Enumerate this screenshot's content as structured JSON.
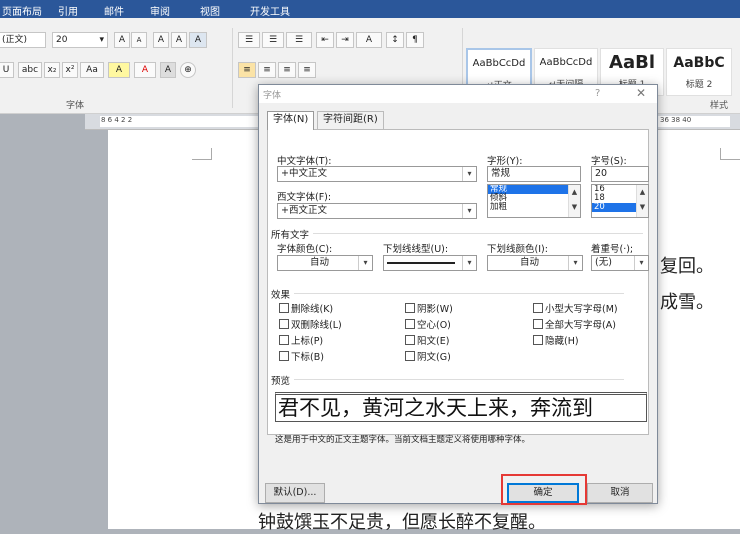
{
  "ribbon_tabs": [
    "页面布局",
    "引用",
    "邮件",
    "审阅",
    "视图",
    "开发工具"
  ],
  "ribbon": {
    "font_name": "(正文)",
    "font_size": "20",
    "grow_font": "A",
    "shrink_font": "A",
    "clear_format": "A",
    "phonetic_guide": "A",
    "group_font": "字体",
    "group_styles": "样式",
    "font_row2": [
      "abc",
      "x₂",
      "x²",
      "Aa",
      "A",
      "A",
      "A"
    ],
    "para_row1": [
      "☰",
      "☰",
      "☰",
      "⇤",
      "⇥",
      "A",
      "↕",
      "¶"
    ],
    "styles": [
      {
        "sample": "AaBbCcDd",
        "name": "↵正文"
      },
      {
        "sample": "AaBbCcDd",
        "name": "↵无间隔"
      },
      {
        "sample": "AaBl",
        "name": "标题 1"
      },
      {
        "sample": "AaBbC",
        "name": "标题 2"
      }
    ],
    "ruler_marks": "8   6   4   2       2",
    "ruler_marks_right": "36   38   40"
  },
  "document": {
    "line_partial_1": "复回。",
    "line_partial_2": "成雪。",
    "line_bottom": "钟鼓馔玉不足贵，但愿长醉不复醒。"
  },
  "dialog": {
    "title": "字体",
    "help": "?",
    "close": "✕",
    "tabs": [
      "字体(N)",
      "字符间距(R)"
    ],
    "cn_font_label": "中文字体(T):",
    "cn_font_value": "+中文正文",
    "west_font_label": "西文字体(F):",
    "west_font_value": "+西文正文",
    "style_label": "字形(Y):",
    "style_value": "常规",
    "style_list": [
      "常规",
      "倾斜",
      "加粗"
    ],
    "size_label": "字号(S):",
    "size_value": "20",
    "size_list": [
      "16",
      "18",
      "20"
    ],
    "all_text_label": "所有文字",
    "font_color_label": "字体颜色(C):",
    "font_color_value": "自动",
    "underline_type_label": "下划线线型(U):",
    "underline_color_label": "下划线颜色(I):",
    "underline_color_value": "自动",
    "emphasis_label": "着重号(·);",
    "emphasis_value": "(无)",
    "effects_label": "效果",
    "effects": [
      "删除线(K)",
      "阴影(W)",
      "小型大写字母(M)",
      "双删除线(L)",
      "空心(O)",
      "全部大写字母(A)",
      "上标(P)",
      "阳文(E)",
      "隐藏(H)",
      "下标(B)",
      "阴文(G)"
    ],
    "preview_label": "预览",
    "preview_text": "君不见，黄河之水天上来，奔流到",
    "note": "这是用于中文的正文主题字体。当前文档主题定义将使用哪种字体。",
    "default_button": "默认(D)...",
    "ok_button": "确定",
    "cancel_button": "取消"
  },
  "colors": {
    "ribbon_tab": "#2b579a",
    "highlight": "#e53935",
    "selection": "#1e73e8"
  }
}
